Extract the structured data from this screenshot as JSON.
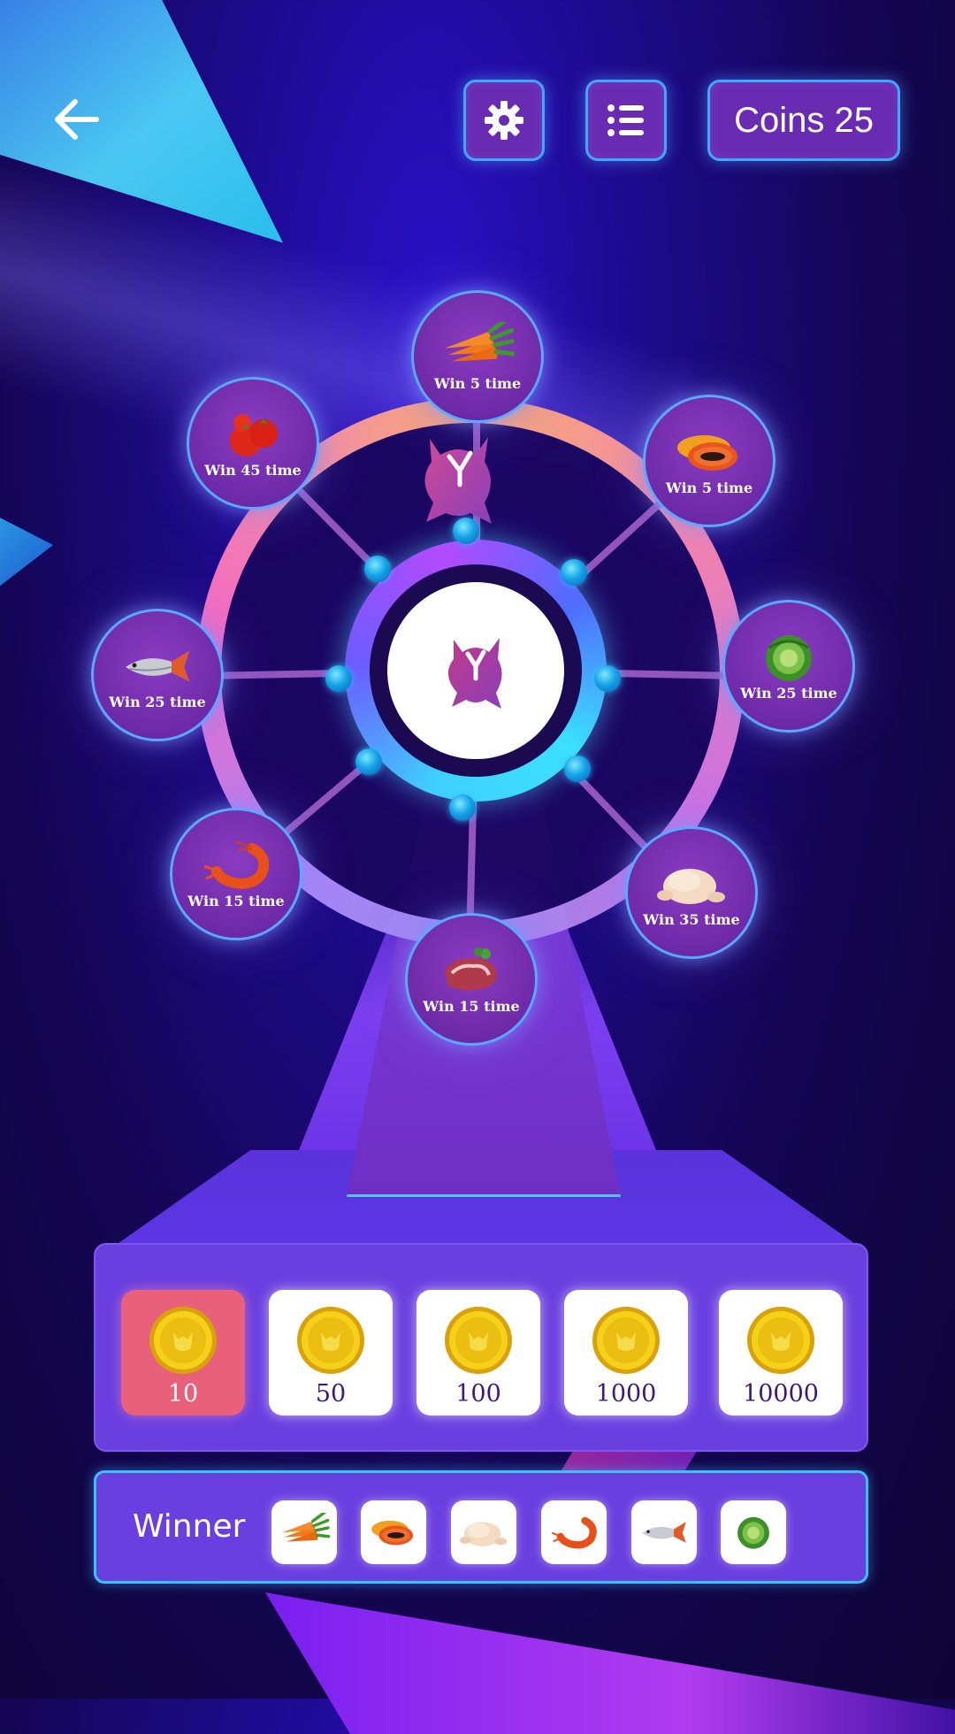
{
  "header": {
    "coins_label": "Coins 25"
  },
  "wheel": {
    "center_logo": "owl-logo",
    "prizes": [
      {
        "item": "carrot",
        "label": "Win 5 time"
      },
      {
        "item": "papaya",
        "label": "Win 5 time"
      },
      {
        "item": "cabbage",
        "label": "Win 25 time"
      },
      {
        "item": "chicken",
        "label": "Win 35 time"
      },
      {
        "item": "meat",
        "label": "Win 15 time"
      },
      {
        "item": "shrimp",
        "label": "Win 15 time"
      },
      {
        "item": "fish",
        "label": "Win 25 time"
      },
      {
        "item": "tomato",
        "label": "Win 45 time"
      }
    ]
  },
  "bets": {
    "selected_index": 0,
    "chips": [
      {
        "value": "10"
      },
      {
        "value": "50"
      },
      {
        "value": "100"
      },
      {
        "value": "1000"
      },
      {
        "value": "10000"
      }
    ]
  },
  "winner": {
    "label": "Winner",
    "items": [
      "carrot",
      "papaya",
      "chicken",
      "shrimp",
      "fish",
      "cabbage"
    ]
  },
  "colors": {
    "accent_border": "#3ea8ff",
    "button_fill": "#6a2bb3",
    "panel": "#6a3fe0",
    "selected_chip": "#e8607a"
  }
}
